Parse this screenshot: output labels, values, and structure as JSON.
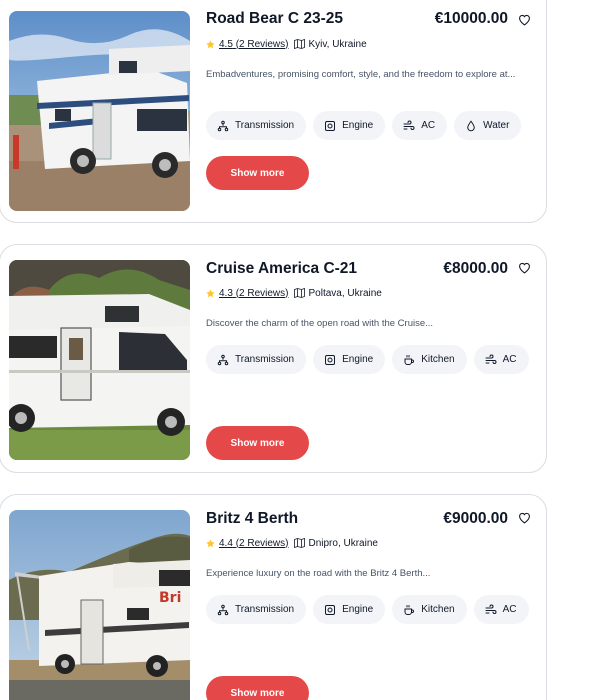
{
  "colors": {
    "accent": "#e44848",
    "rating_star": "#ffc531",
    "tag_bg": "#f2f4f7",
    "text_primary": "#101828",
    "text_secondary": "#475467"
  },
  "campers": [
    {
      "title": "Road Bear C 23-25",
      "price": "€10000.00",
      "rating": "4.5",
      "reviews": "(2 Reviews)",
      "location": "Kyiv, Ukraine",
      "description": "Embadventures, promising comfort, style, and the freedom to explore at...",
      "features": [
        {
          "label": "Transmission",
          "icon": "transmission-icon"
        },
        {
          "label": "Engine",
          "icon": "engine-icon"
        },
        {
          "label": "AC",
          "icon": "ac-icon"
        },
        {
          "label": "Water",
          "icon": "water-icon"
        }
      ],
      "button_label": "Show more"
    },
    {
      "title": "Cruise America C-21",
      "price": "€8000.00",
      "rating": "4.3",
      "reviews": "(2 Reviews)",
      "location": "Poltava, Ukraine",
      "description": "Discover the charm of the open road with the Cruise...",
      "features": [
        {
          "label": "Transmission",
          "icon": "transmission-icon"
        },
        {
          "label": "Engine",
          "icon": "engine-icon"
        },
        {
          "label": "Kitchen",
          "icon": "kitchen-icon"
        },
        {
          "label": "AC",
          "icon": "ac-icon"
        }
      ],
      "button_label": "Show more"
    },
    {
      "title": "Britz 4 Berth",
      "price": "€9000.00",
      "rating": "4.4",
      "reviews": "(2 Reviews)",
      "location": "Dnipro, Ukraine",
      "description": "Experience luxury on the road with the Britz 4 Berth...",
      "features": [
        {
          "label": "Transmission",
          "icon": "transmission-icon"
        },
        {
          "label": "Engine",
          "icon": "engine-icon"
        },
        {
          "label": "Kitchen",
          "icon": "kitchen-icon"
        },
        {
          "label": "AC",
          "icon": "ac-icon"
        }
      ],
      "button_label": "Show more"
    }
  ]
}
